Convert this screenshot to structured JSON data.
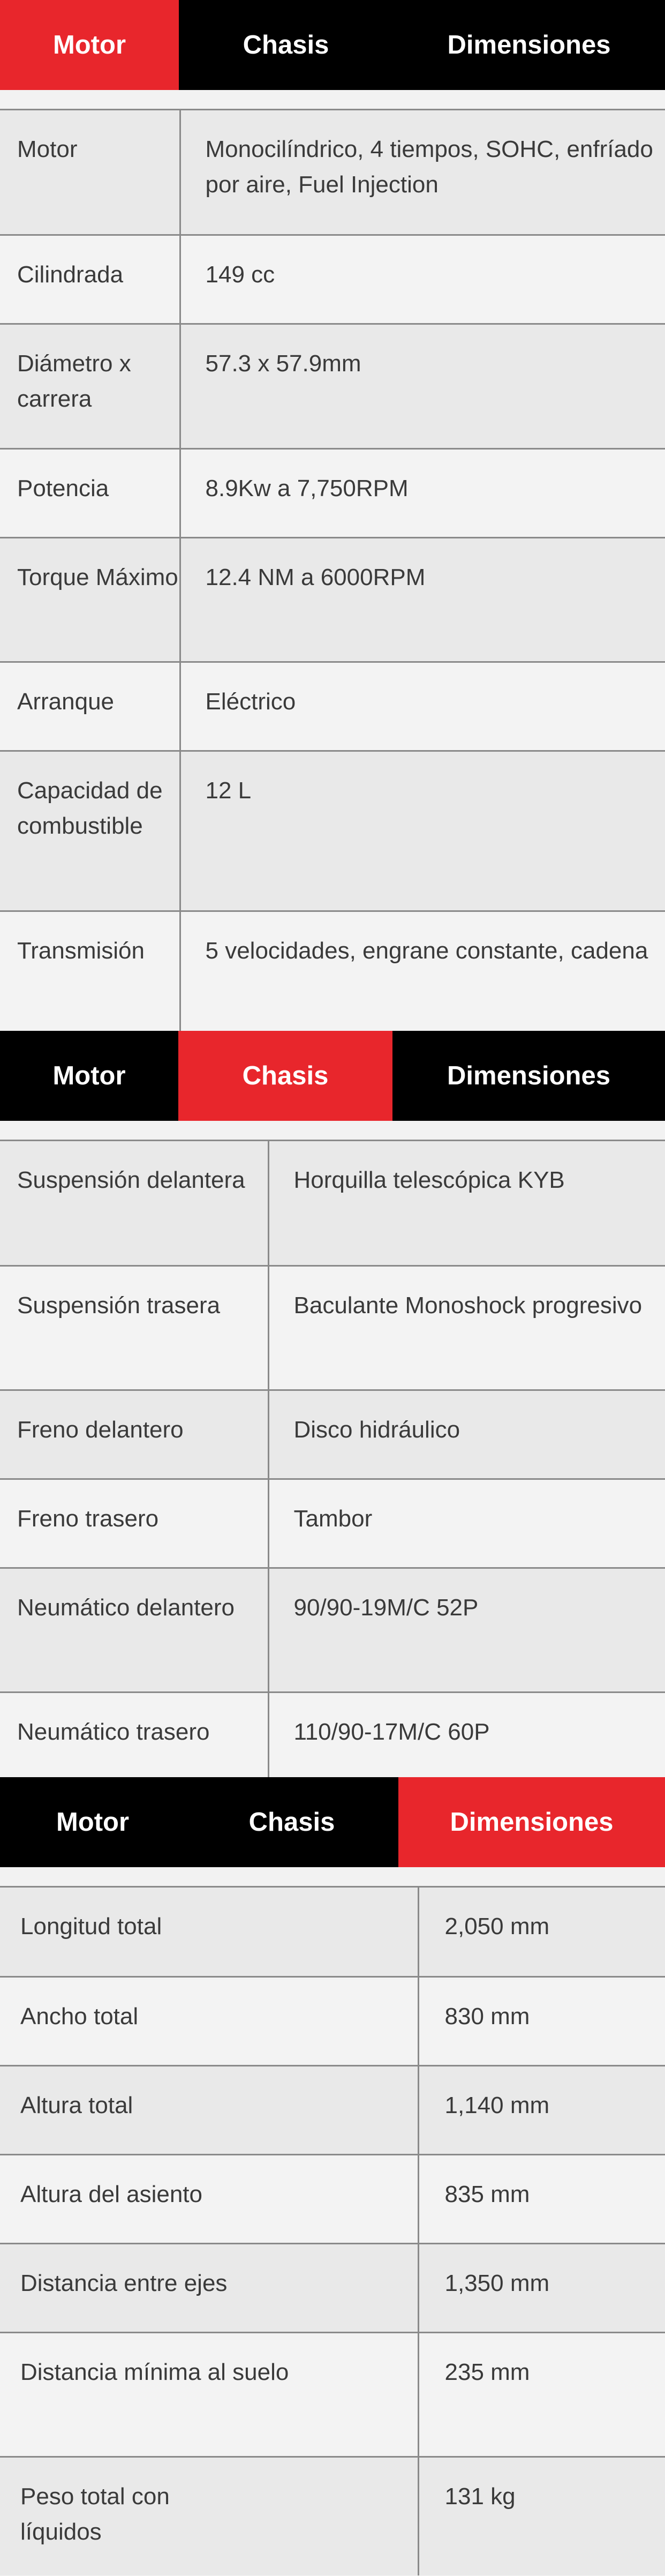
{
  "tab_labels": {
    "motor": "Motor",
    "chasis": "Chasis",
    "dimensiones": "Dimensiones"
  },
  "colors": {
    "active_tab": "#e8262c",
    "tab_bar": "#000000",
    "row_odd": "#e9e9e9",
    "row_even": "#f3f3f3"
  },
  "motor": {
    "rows": [
      {
        "label": "Motor",
        "value": "Monocilíndrico, 4 tiempos, SOHC, enfríado por aire, Fuel Injection"
      },
      {
        "label": "Cilindrada",
        "value": "149 cc"
      },
      {
        "label": "Diámetro x carrera",
        "value": "57.3 x 57.9mm"
      },
      {
        "label": "Potencia",
        "value": "8.9Kw a 7,750RPM"
      },
      {
        "label": "Torque Máximo",
        "value": "12.4 NM a 6000RPM"
      },
      {
        "label": "Arranque",
        "value": "Eléctrico"
      },
      {
        "label": "Capacidad de combustible",
        "value": "12 L"
      },
      {
        "label": "Transmisión",
        "value": "5 velocidades, engrane constante, cadena"
      }
    ]
  },
  "chasis": {
    "rows": [
      {
        "label": "Suspensión delantera",
        "value": "Horquilla telescópica KYB"
      },
      {
        "label": "Suspensión trasera",
        "value": "Baculante Monoshock progresivo"
      },
      {
        "label": "Freno delantero",
        "value": "Disco hidráulico"
      },
      {
        "label": "Freno trasero",
        "value": "Tambor"
      },
      {
        "label": "Neumático delantero",
        "value": "90/90-19M/C 52P"
      },
      {
        "label": "Neumático trasero",
        "value": "110/90-17M/C 60P"
      }
    ]
  },
  "dimensiones": {
    "rows": [
      {
        "label": "Longitud total",
        "value": "2,050 mm"
      },
      {
        "label": "Ancho total",
        "value": "830 mm"
      },
      {
        "label": "Altura total",
        "value": "1,140 mm"
      },
      {
        "label": "Altura del asiento",
        "value": "835 mm"
      },
      {
        "label": "Distancia entre ejes",
        "value": "1,350 mm"
      },
      {
        "label": "Distancia mínima al suelo",
        "value": "235 mm"
      },
      {
        "label": "Peso total con líquidos",
        "value": "131 kg"
      }
    ]
  }
}
